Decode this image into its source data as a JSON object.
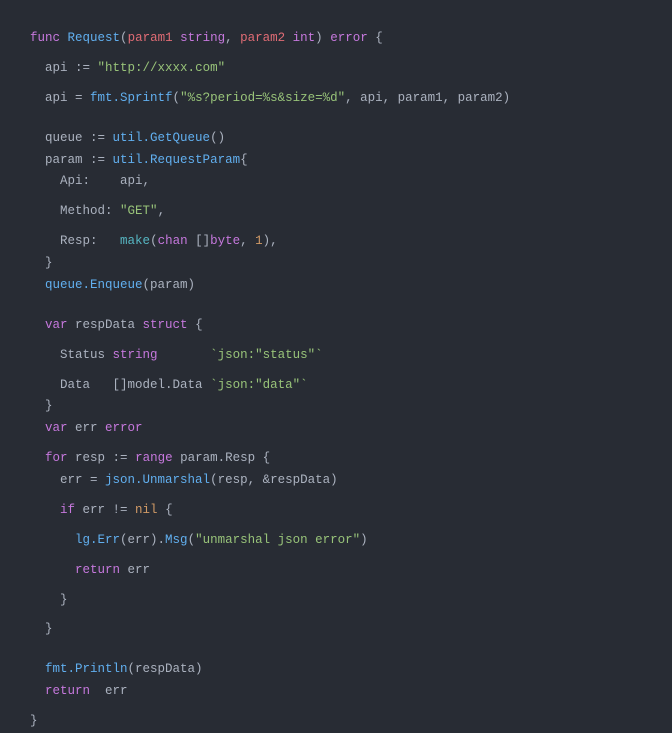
{
  "code": {
    "line1": {
      "func": "func",
      "name": "Request",
      "param1": "param1",
      "string": "string",
      "param2": "param2",
      "int": "int",
      "error": "error",
      "brace": " {"
    },
    "line2": {
      "var": "api",
      "assign": " := ",
      "val": "\"http://xxxx.com\""
    },
    "line3": {
      "var": "api = ",
      "fn": "fmt.Sprintf",
      "open": "(",
      "str": "\"%s?period=%s&size=%d\"",
      "args": ", api, param1, param2)"
    },
    "line4": {
      "var": "queue",
      "assign": " := ",
      "fn": "util.GetQueue",
      "rest": "()"
    },
    "line5": {
      "var": "param",
      "assign": " := ",
      "fn": "util.RequestParam",
      "brace": "{"
    },
    "line6": {
      "key": "Api:",
      "val": "    api,"
    },
    "line7": {
      "key": "Method:",
      "val": " ",
      "str": "\"GET\"",
      "comma": ","
    },
    "line8": {
      "key": "Resp:",
      "sp": "   ",
      "make": "make",
      "open": "(",
      "chan": "chan",
      "bracket": " []",
      "byte": "byte",
      "rest": ", ",
      "num": "1",
      "close": "),"
    },
    "line9": {
      "brace": "}"
    },
    "line10": {
      "fn": "queue.Enqueue",
      "args": "(param)"
    },
    "line11": {
      "var": "var",
      "name": " respData ",
      "struct": "struct",
      "brace": " {"
    },
    "line12": {
      "key": "Status ",
      "type": "string",
      "pad": "       ",
      "tag": "`json:\"status\"`"
    },
    "line13": {
      "key": "Data   ",
      "br": "[]",
      "type": "model.Data ",
      "tag": "`json:\"data\"`"
    },
    "line14": {
      "brace": "}"
    },
    "line15": {
      "var": "var",
      "name": " err ",
      "type": "error"
    },
    "line16": {
      "for": "for",
      "name": " resp ",
      "assign": ":= ",
      "range": "range",
      "rest": " param.Resp {"
    },
    "line17": {
      "lhs": "err = ",
      "fn": "json.Unmarshal",
      "args": "(resp, &respData)"
    },
    "line18": {
      "if": "if",
      "cond": " err != ",
      "nil": "nil",
      "brace": " {"
    },
    "line19": {
      "fn1": "lg.Err",
      "args1": "(err).",
      "fn2": "Msg",
      "open": "(",
      "str": "\"unmarshal json error\"",
      "close": ")"
    },
    "line20": {
      "ret": "return",
      "val": " err"
    },
    "line21": {
      "brace": "}"
    },
    "line22": {
      "brace": "}"
    },
    "line23": {
      "fn": "fmt.Println",
      "args": "(respData)"
    },
    "line24": {
      "ret": "return",
      "val": "  err"
    },
    "line25": {
      "brace": "}"
    }
  }
}
